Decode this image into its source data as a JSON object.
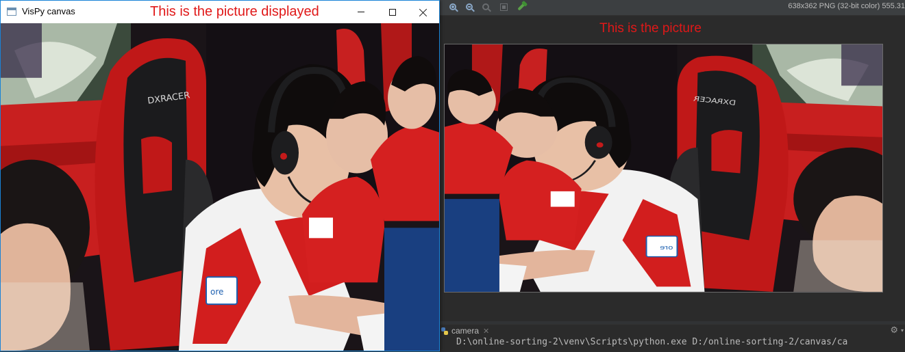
{
  "vispy_window": {
    "title": "VisPy canvas",
    "caption": "This is the picture displayed",
    "buttons": {
      "minimize": "minimize-icon",
      "maximize": "maximize-icon",
      "close": "close-icon"
    },
    "border_color": "#1883d7",
    "image": "esports players wearing headsets at gaming chairs (stretched)"
  },
  "image_viewer": {
    "toolbar_icons": [
      "zoom-in-icon",
      "zoom-out-icon",
      "actual-size-icon",
      "fit-frame-icon",
      "color-picker-icon"
    ],
    "image_info": "638x362 PNG (32-bit color) 555.31",
    "caption": "This is the picture",
    "image": "esports players wearing headsets at gaming chairs (horizontally mirrored)"
  },
  "run_panel": {
    "tab_label": "camera",
    "console_text": "D:\\online-sorting-2\\venv\\Scripts\\python.exe D:/online-sorting-2/canvas/ca"
  },
  "colors": {
    "caption_red": "#e01818",
    "ide_bg": "#2b2b2b",
    "toolbar_bg": "#3c3f41"
  }
}
